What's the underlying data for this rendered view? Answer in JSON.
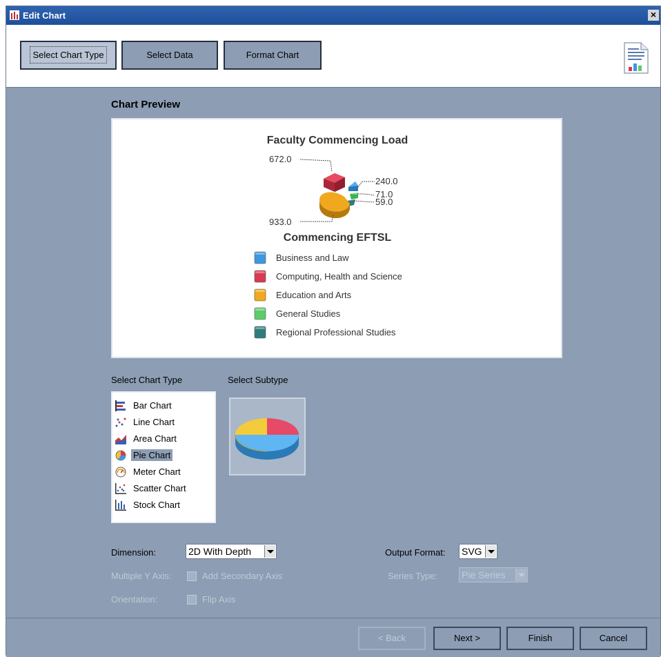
{
  "window": {
    "title": "Edit Chart",
    "close_label": "×"
  },
  "steps": {
    "select_chart_type": "Select Chart Type",
    "select_data": "Select Data",
    "format_chart": "Format Chart"
  },
  "preview": {
    "heading": "Chart Preview",
    "chart_title": "Faculty Commencing Load",
    "legend_title": "Commencing EFTSL",
    "data_labels": [
      "672.0",
      "240.0",
      "71.0",
      "59.0",
      "933.0"
    ]
  },
  "chart_data": {
    "type": "pie",
    "title": "Faculty Commencing Load",
    "legend_title": "Commencing EFTSL",
    "categories": [
      "Business and Law",
      "Computing, Health and Science",
      "Education and Arts",
      "General Studies",
      "Regional Professional Studies"
    ],
    "values": [
      240.0,
      672.0,
      933.0,
      71.0,
      59.0
    ],
    "colors": [
      "#3f97dd",
      "#d83a52",
      "#f0a81e",
      "#5ccc6a",
      "#2f7d7a"
    ],
    "legend_placement": "bottom",
    "dimension": "2D With Depth"
  },
  "chart_type": {
    "label": "Select Chart Type",
    "subtype_label": "Select Subtype",
    "items": [
      {
        "label": "Bar Chart",
        "icon": "bar-chart-icon"
      },
      {
        "label": "Line Chart",
        "icon": "line-chart-icon"
      },
      {
        "label": "Area Chart",
        "icon": "area-chart-icon"
      },
      {
        "label": "Pie Chart",
        "icon": "pie-chart-icon",
        "selected": true
      },
      {
        "label": "Meter Chart",
        "icon": "meter-chart-icon"
      },
      {
        "label": "Scatter Chart",
        "icon": "scatter-chart-icon"
      },
      {
        "label": "Stock Chart",
        "icon": "stock-chart-icon"
      }
    ]
  },
  "options": {
    "dimension_label": "Dimension:",
    "dimension_value": "2D With Depth",
    "multi_y_label": "Multiple Y Axis:",
    "add_secondary_label": "Add Secondary Axis",
    "orientation_label": "Orientation:",
    "flip_axis_label": "Flip Axis",
    "output_format_label": "Output Format:",
    "output_format_value": "SVG",
    "series_type_label": "Series Type:",
    "series_type_value": "Pie Series"
  },
  "footer": {
    "back": "< Back",
    "next": "Next >",
    "finish": "Finish",
    "cancel": "Cancel"
  }
}
